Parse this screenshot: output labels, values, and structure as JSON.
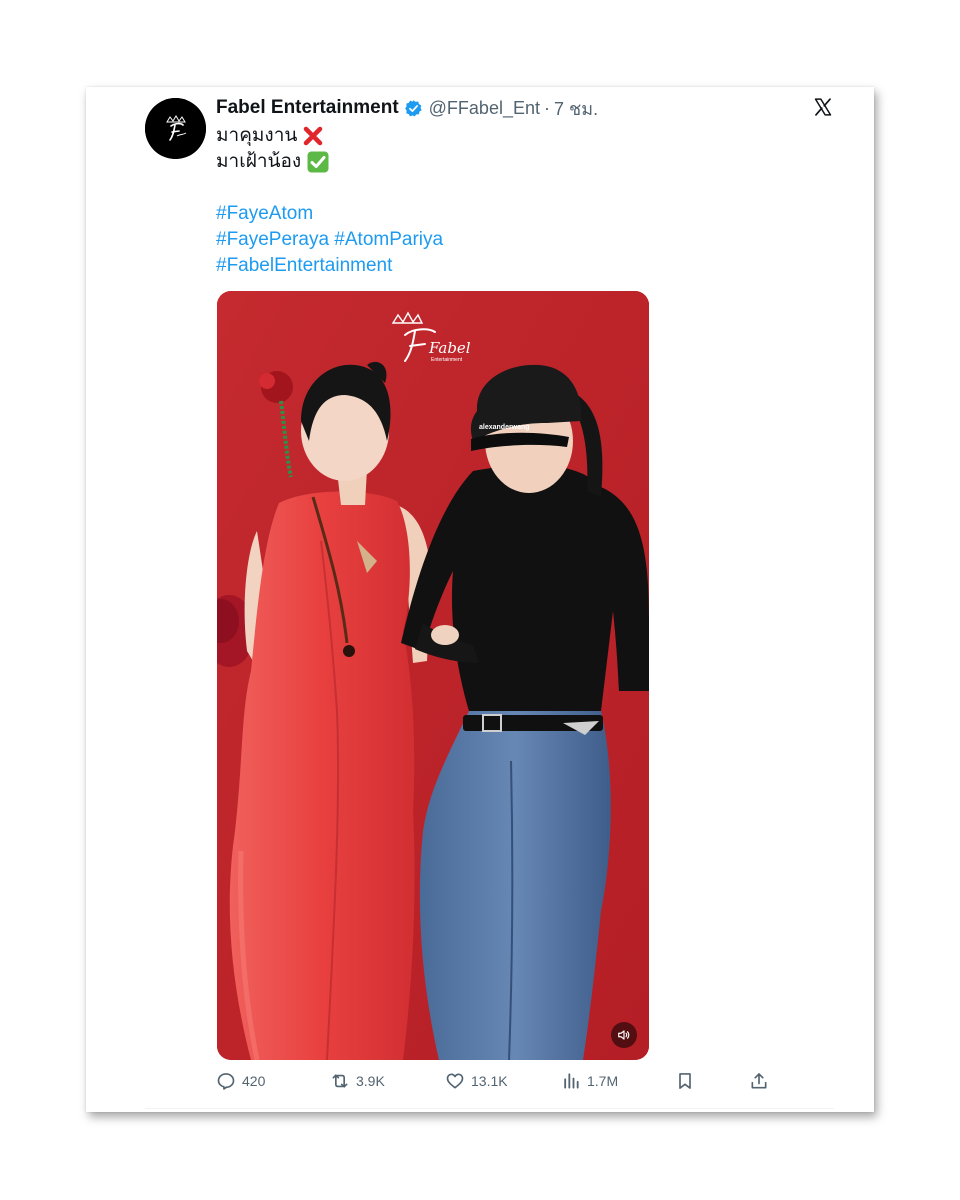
{
  "tweet": {
    "author_name": "Fabel Entertainment",
    "handle": "@FFabel_Ent",
    "separator": "·",
    "time": "7 ชม.",
    "text_lines": [
      {
        "text": "มาคุมงาน",
        "emoji": "cross-mark-emoji"
      },
      {
        "text": "มาเฝ้าน้อง",
        "emoji": "check-mark-button-emoji"
      }
    ],
    "hashtags": {
      "line1": "#FayeAtom",
      "line2a": "#FayePeraya",
      "line2b": "#AtomPariya",
      "line3": "#FabelEntertainment"
    },
    "avatar_logo_text": "Fabel",
    "media": {
      "type": "video-thumbnail",
      "watermark_text": "Fabel",
      "watermark_subtext": "Entertainment",
      "volume_icon": "speaker-icon"
    },
    "actions": {
      "replies": "420",
      "reposts": "3.9K",
      "likes": "13.1K",
      "views": "1.7M"
    }
  },
  "colors": {
    "link": "#1d9bf0",
    "text": "#0f1419",
    "muted": "#536471",
    "verified": "#1d9bf0",
    "media_background": "#c9262c"
  }
}
